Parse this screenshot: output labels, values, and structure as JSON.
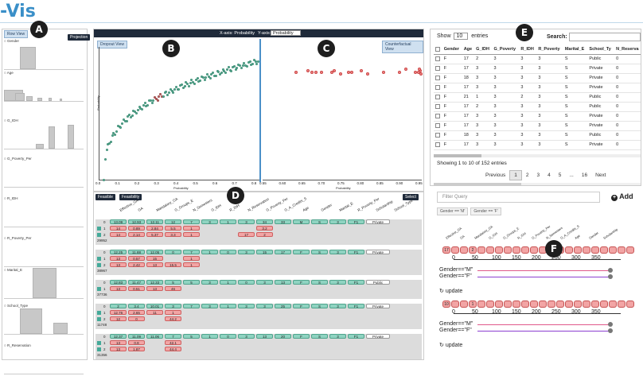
{
  "app": {
    "title": "-Vis"
  },
  "markers": {
    "a": "A",
    "b": "B",
    "c": "C",
    "d": "D",
    "e": "E",
    "f": "F"
  },
  "row_view": {
    "tab_label": "Row View",
    "projection_label": "Projection",
    "attributes": [
      "Gender",
      "Age",
      "G_IDH",
      "G_Poverty_Per",
      "R_IDH",
      "R_Poverty_Per",
      "Marital_E",
      "School_Type",
      "R_Reservation"
    ]
  },
  "scatter": {
    "x_axis_label": "X-axis: Probability",
    "y_axis_label": "Y-axis:",
    "y_select_value": "Probability",
    "dropout_tab": "Dropout View",
    "counterfactual_tab": "Counterfactual View",
    "left_xlabel": "Probability",
    "left_ylabel": "Probability",
    "right_xlabel": "Probability",
    "left_ticks": [
      "0.0",
      "0.1",
      "0.2",
      "0.3",
      "0.4",
      "0.5",
      "0.6",
      "0.7",
      "0.8"
    ],
    "right_ticks": [
      "0.55",
      "0.60",
      "0.65",
      "0.70",
      "0.75",
      "0.80",
      "0.85",
      "0.90",
      "0.95"
    ]
  },
  "feasibility": {
    "feasible_tab": "Feasible",
    "feasibility_tab": "Feasibility",
    "select_button": "Select",
    "columns": [
      "Effective_GA",
      "GA",
      "Mandatory_GA",
      "G_Groups_E",
      "N_Semesters",
      "G_IDH",
      "R_IDH",
      "N_Reservation",
      "G_Poverty_Per",
      "G_A_Credits_S",
      "Age",
      "Gender",
      "Marital_E",
      "R_Poverty_Per",
      "Scholarship",
      "School_Type"
    ],
    "groups": [
      {
        "id": "29952",
        "rows": [
          {
            "idx": "0",
            "vals": [
              "13.09",
              "12.93",
              "12.11",
              "12",
              "7",
              "3",
              "1",
              "3",
              "34",
              "33",
              "M",
              "S",
              "3",
              "F1",
              "Private"
            ]
          },
          {
            "idx": "1",
            "vals": [
              "14",
              "0.89",
              "2.84",
              "5.5",
              "1",
              "",
              "",
              "",
              "3.2"
            ]
          },
          {
            "idx": "2",
            "vals": [
              "14",
              "2.14",
              "5.37",
              "3.3",
              "1",
              "",
              "",
              "17",
              "2"
            ]
          }
        ]
      },
      {
        "id": "38967",
        "rows": [
          {
            "idx": "0",
            "vals": [
              "12.25",
              "11.88",
              "12.05",
              "0",
              "7",
              "1",
              "0",
              "3",
              "15",
              "17",
              "F",
              "S",
              "3",
              "F1",
              "Private"
            ]
          },
          {
            "idx": "1",
            "vals": [
              "13",
              "0.57",
              "15",
              "",
              "1"
            ]
          },
          {
            "idx": "2",
            "vals": [
              "13",
              "2.42",
              "13",
              "15.5",
              "1"
            ]
          }
        ]
      },
      {
        "id": "37736",
        "rows": [
          {
            "idx": "0",
            "vals": [
              "12.83",
              "11.47",
              "12.33",
              "5",
              "5",
              "3",
              "1",
              "0",
              "3",
              "13",
              "F",
              "S",
              "3",
              "F1",
              "Public"
            ]
          },
          {
            "idx": "1",
            "vals": [
              "13",
              "0.51",
              "13",
              "46"
            ]
          }
        ]
      },
      {
        "id": "11748",
        "rows": [
          {
            "idx": "0",
            "vals": [
              "2",
              "3.4",
              "10.01",
              "3",
              "7",
              "3",
              "1",
              "3",
              "3",
              "25",
              "F",
              "S",
              "3",
              "F1",
              "Private"
            ]
          },
          {
            "idx": "1",
            "vals": [
              "12.76",
              "2.65",
              "11",
              "1"
            ]
          },
          {
            "idx": "2",
            "vals": [
              "12",
              "0",
              "",
              "44.2"
            ]
          }
        ]
      },
      {
        "id": "31356",
        "rows": [
          {
            "idx": "0",
            "vals": [
              "12.37",
              "11.09",
              "11.06",
              "7",
              "5",
              "1",
              "0",
              "3",
              "13",
              "20",
              "F",
              "S",
              "3",
              "F1",
              "Private"
            ]
          },
          {
            "idx": "1",
            "vals": [
              "13",
              "0.8",
              "",
              "42.1"
            ]
          },
          {
            "idx": "2",
            "vals": [
              "13",
              "1.87",
              "",
              "44.4"
            ]
          }
        ]
      }
    ]
  },
  "table": {
    "show_label": "Show",
    "entries_select": "10",
    "entries_label": "entries",
    "search_label": "Search:",
    "search_value": "",
    "headers": [
      "Gender",
      "Age",
      "G_IDH",
      "G_Poverty_Per",
      "R_IDH",
      "R_Poverty_Per",
      "Marital_E",
      "School_Type",
      "N_Reservation"
    ],
    "rows": [
      [
        "F",
        "17",
        "2",
        "3",
        "3",
        "3",
        "S",
        "Public",
        "0"
      ],
      [
        "F",
        "17",
        "3",
        "3",
        "3",
        "3",
        "S",
        "Private",
        "0"
      ],
      [
        "F",
        "18",
        "3",
        "3",
        "3",
        "3",
        "S",
        "Private",
        "0"
      ],
      [
        "F",
        "17",
        "3",
        "3",
        "3",
        "3",
        "S",
        "Private",
        "0"
      ],
      [
        "F",
        "21",
        "1",
        "3",
        "2",
        "3",
        "S",
        "Public",
        "0"
      ],
      [
        "F",
        "17",
        "2",
        "3",
        "3",
        "3",
        "S",
        "Public",
        "0"
      ],
      [
        "F",
        "17",
        "3",
        "3",
        "3",
        "3",
        "S",
        "Private",
        "0"
      ],
      [
        "F",
        "17",
        "3",
        "3",
        "3",
        "3",
        "S",
        "Private",
        "0"
      ],
      [
        "F",
        "18",
        "3",
        "3",
        "3",
        "3",
        "S",
        "Public",
        "0"
      ],
      [
        "F",
        "17",
        "3",
        "3",
        "3",
        "3",
        "S",
        "Private",
        "0"
      ]
    ],
    "info": "Showing 1 to 10 of 152 entries",
    "pagination": [
      "Previous",
      "1",
      "2",
      "3",
      "4",
      "5",
      "...",
      "16",
      "Next"
    ]
  },
  "filter": {
    "placeholder": "Filter Query",
    "add_label": "Add",
    "chips": [
      "Gender == 'M'",
      "Gender == 'F'"
    ]
  },
  "fairness": {
    "header_labels": [
      "Effective_GA",
      "GA",
      "Mandatory_GA",
      "G_IDH",
      "G_Groups_E",
      "R_IDH",
      "G_Poverty_Per",
      "N_Semesters",
      "G_A_Credits_S",
      "Age",
      "Gender",
      "Scholarship"
    ],
    "blocks": [
      {
        "id_label": "17",
        "second_label": "2",
        "ticks": [
          "0",
          "50",
          "100",
          "150",
          "200",
          "250",
          "300",
          "350"
        ],
        "cond1": "Gender==\"M\"",
        "cond2": "Gender==\"F\"",
        "update": "update"
      },
      {
        "id_label": "10",
        "second_label": "1",
        "ticks": [
          "0",
          "50",
          "100",
          "150",
          "200",
          "250",
          "300",
          "350"
        ],
        "cond1": "Gender==\"M\"",
        "cond2": "Gender==\"F\"",
        "update": "update"
      }
    ]
  },
  "colors": {
    "accent": "#3a8fc8",
    "feasible_green": "#8fd3c1",
    "infeasible_red": "#f2a5a5",
    "dark_header": "#1f2a3a"
  }
}
